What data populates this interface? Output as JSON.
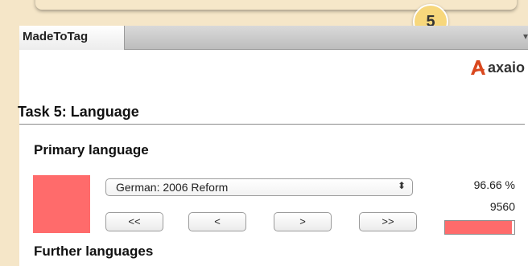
{
  "step_badge": "5",
  "tab": {
    "label": "MadeToTag"
  },
  "logo": {
    "text": "axaio"
  },
  "task": {
    "title": "Task 5: Language"
  },
  "primary": {
    "heading": "Primary language",
    "swatch_color": "#ff6b6b",
    "selected_language": "German: 2006 Reform",
    "percent": "96.66 %",
    "count": "9560",
    "progress_fraction": 0.9666
  },
  "nav": {
    "first": "<<",
    "prev": "<",
    "next": ">",
    "last": ">>"
  },
  "further": {
    "heading": "Further languages"
  },
  "colors": {
    "accent": "#ff6b6b",
    "logo_red": "#d9481e",
    "badge": "#f7d77c"
  }
}
